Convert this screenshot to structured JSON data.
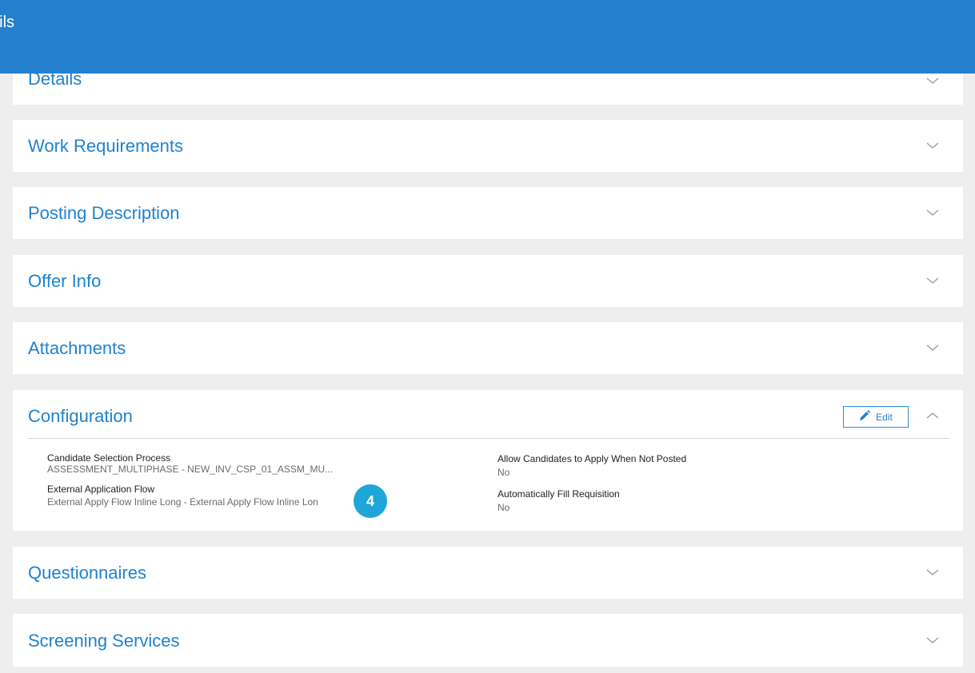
{
  "header": {
    "title": "ails"
  },
  "sections": {
    "details": {
      "title": "Details"
    },
    "work_requirements": {
      "title": "Work Requirements"
    },
    "posting_description": {
      "title": "Posting Description"
    },
    "offer_info": {
      "title": "Offer Info"
    },
    "attachments": {
      "title": "Attachments"
    },
    "configuration": {
      "title": "Configuration",
      "edit_label": "Edit",
      "fields": {
        "candidate_selection": {
          "label": "Candidate Selection Process",
          "value": "ASSESSMENT_MULTIPHASE - NEW_INV_CSP_01_ASSM_MU..."
        },
        "external_flow": {
          "label": "External Application Flow",
          "value": "External Apply Flow Inline Long - External Apply Flow Inline Lon"
        },
        "allow_apply": {
          "label": "Allow Candidates to Apply When Not Posted",
          "value": "No"
        },
        "auto_fill": {
          "label": "Automatically Fill Requisition",
          "value": "No"
        }
      },
      "badge": "4"
    },
    "questionnaires": {
      "title": "Questionnaires"
    },
    "screening_services": {
      "title": "Screening Services"
    }
  },
  "icons": {
    "chevron": "chevron-down-icon",
    "collapse": "chevron-up-icon",
    "edit": "pencil-icon"
  },
  "colors": {
    "header": "#2580d0",
    "link": "#1f82cf",
    "badge": "#1fa6d9"
  }
}
